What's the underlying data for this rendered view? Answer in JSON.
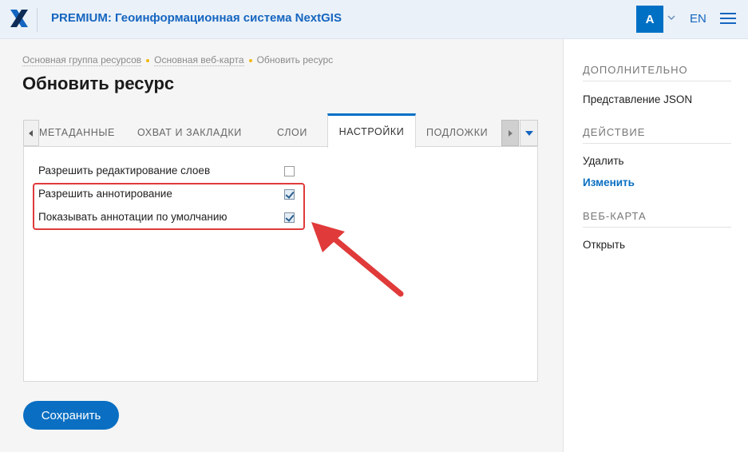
{
  "header": {
    "title": "PREMIUM: Геоинформационная система NextGIS",
    "avatar_letter": "A",
    "language": "EN"
  },
  "breadcrumb": [
    "Основная группа ресурсов",
    "Основная веб-карта",
    "Обновить ресурс"
  ],
  "page_title": "Обновить ресурс",
  "tabs": [
    "Метаданные",
    "Охват и закладки",
    "Слои",
    "Настройки",
    "Подложки"
  ],
  "active_tab": "Настройки",
  "settings": [
    {
      "label": "Разрешить редактирование слоев",
      "checked": false
    },
    {
      "label": "Разрешить аннотирование",
      "checked": true
    },
    {
      "label": "Показывать аннотации по умолчанию",
      "checked": true
    }
  ],
  "save_label": "Сохранить",
  "sidebar": {
    "section_extra": "Дополнительно",
    "json_view": "Представление JSON",
    "section_action": "Действие",
    "delete": "Удалить",
    "edit": "Изменить",
    "section_webmap": "Веб-карта",
    "open": "Открыть"
  },
  "colors": {
    "accent": "#0a6fc2",
    "highlight": "#e03a3a"
  },
  "icons": [
    "nextgis-logo-icon",
    "chevron-down-icon",
    "hamburger-menu-icon",
    "chevron-left-icon",
    "chevron-right-icon",
    "dropdown-arrow-icon",
    "red-arrow-annotation"
  ]
}
